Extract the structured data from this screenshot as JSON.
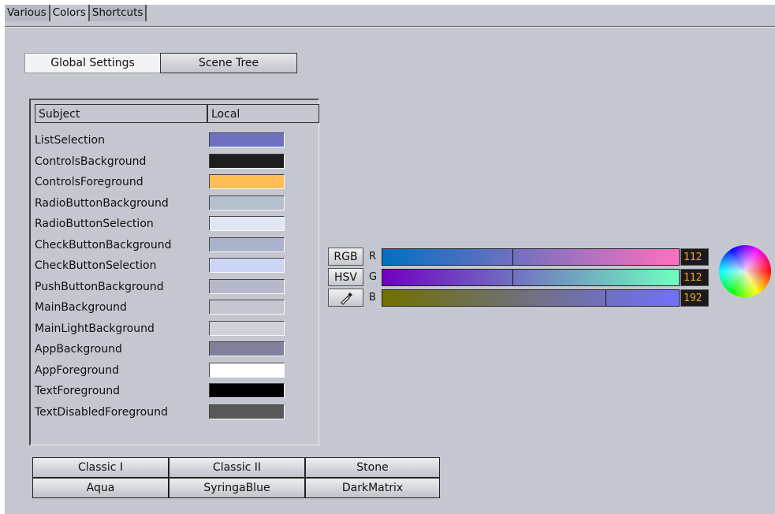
{
  "tabs": [
    "Various",
    "Colors",
    "Shortcuts"
  ],
  "active_tab": "Colors",
  "mode_buttons": {
    "global": "Global Settings",
    "scene": "Scene Tree"
  },
  "list": {
    "headers": {
      "subject": "Subject",
      "local": "Local"
    },
    "rows": [
      {
        "label": "ListSelection",
        "color": "#7070c0"
      },
      {
        "label": "ControlsBackground",
        "color": "#1e1e1e"
      },
      {
        "label": "ControlsForeground",
        "color": "#ffbe55"
      },
      {
        "label": "RadioButtonBackground",
        "color": "#b4c0cc"
      },
      {
        "label": "RadioButtonSelection",
        "color": "#e0e6f4"
      },
      {
        "label": "CheckButtonBackground",
        "color": "#aab2cc"
      },
      {
        "label": "CheckButtonSelection",
        "color": "#ccd6f4"
      },
      {
        "label": "PushButtonBackground",
        "color": "#b4b8c8"
      },
      {
        "label": "MainBackground",
        "color": "#c4c7cf"
      },
      {
        "label": "MainLightBackground",
        "color": "#cfd2d8"
      },
      {
        "label": "AppBackground",
        "color": "#80809c"
      },
      {
        "label": "AppForeground",
        "color": "#ffffff"
      },
      {
        "label": "TextForeground",
        "color": "#000000"
      },
      {
        "label": "TextDisabledForeground",
        "color": "#585858"
      }
    ]
  },
  "presets": [
    [
      "Classic I",
      "Classic II",
      "Stone"
    ],
    [
      "Aqua",
      "SyringaBlue",
      "DarkMatrix"
    ]
  ],
  "color_editor": {
    "mode_rgb": "RGB",
    "mode_hsv": "HSV",
    "picker_icon": "eyedropper-icon",
    "channels": [
      {
        "name": "R",
        "value": "112",
        "level": 112
      },
      {
        "name": "G",
        "value": "112",
        "level": 112
      },
      {
        "name": "B",
        "value": "192",
        "level": 192
      }
    ]
  }
}
